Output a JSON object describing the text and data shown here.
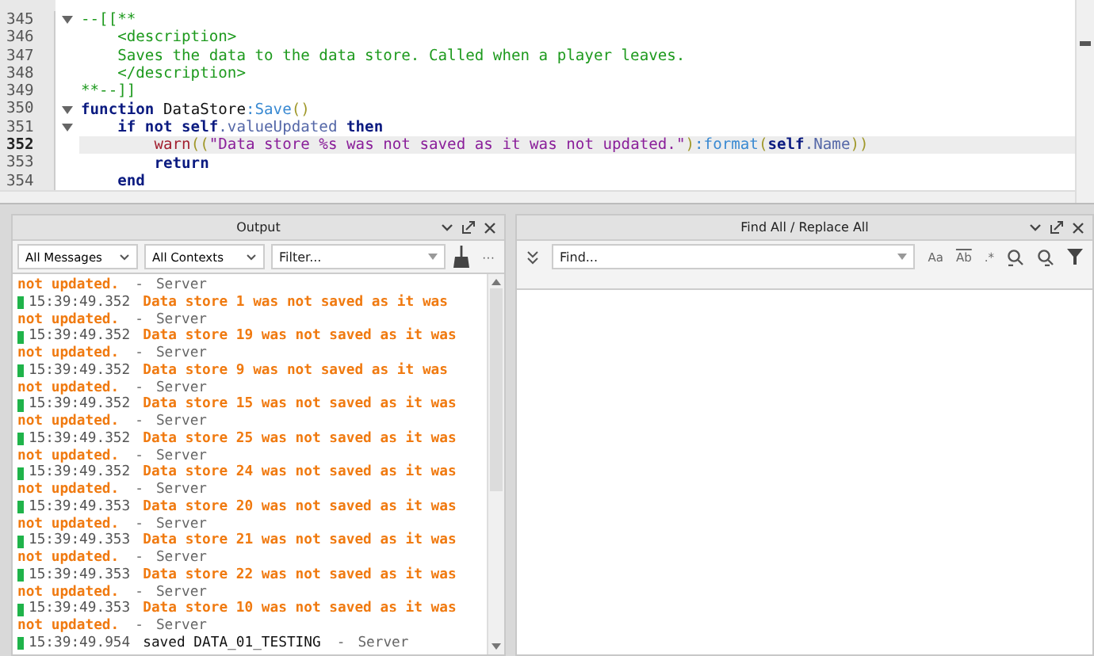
{
  "editor": {
    "lines": [
      {
        "number": "345",
        "fold": true,
        "current": false,
        "tokens": [
          {
            "kind": "comment",
            "text": "--[[**"
          }
        ]
      },
      {
        "number": "346",
        "fold": false,
        "current": false,
        "tokens": [
          {
            "kind": "comment",
            "text": "    <description>"
          }
        ]
      },
      {
        "number": "347",
        "fold": false,
        "current": false,
        "tokens": [
          {
            "kind": "comment",
            "text": "    Saves the data to the data store. Called when a player leaves."
          }
        ]
      },
      {
        "number": "348",
        "fold": false,
        "current": false,
        "tokens": [
          {
            "kind": "comment",
            "text": "    </description>"
          }
        ]
      },
      {
        "number": "349",
        "fold": false,
        "current": false,
        "tokens": [
          {
            "kind": "comment",
            "text": "**--]]"
          }
        ]
      },
      {
        "number": "350",
        "fold": true,
        "current": false,
        "tokens": [
          {
            "kind": "keyword",
            "text": "function"
          },
          {
            "kind": "plain",
            "text": " DataStore"
          },
          {
            "kind": "method",
            "text": ":Save"
          },
          {
            "kind": "paren",
            "text": "()"
          }
        ]
      },
      {
        "number": "351",
        "fold": true,
        "current": false,
        "tokens": [
          {
            "kind": "keyword",
            "text": "    if not self"
          },
          {
            "kind": "property",
            "text": ".valueUpdated"
          },
          {
            "kind": "keyword",
            "text": " then"
          }
        ]
      },
      {
        "number": "352",
        "fold": false,
        "current": true,
        "tokens": [
          {
            "kind": "builtin",
            "text": "        warn"
          },
          {
            "kind": "paren",
            "text": "(("
          },
          {
            "kind": "string",
            "text": "\"Data store %s was not saved as it was not updated.\""
          },
          {
            "kind": "paren",
            "text": ")"
          },
          {
            "kind": "method",
            "text": ":format"
          },
          {
            "kind": "paren",
            "text": "("
          },
          {
            "kind": "keyword",
            "text": "self"
          },
          {
            "kind": "property",
            "text": ".Name"
          },
          {
            "kind": "paren",
            "text": "))"
          }
        ]
      },
      {
        "number": "353",
        "fold": false,
        "current": false,
        "tokens": [
          {
            "kind": "keyword",
            "text": "        return"
          }
        ]
      },
      {
        "number": "354",
        "fold": false,
        "current": false,
        "tokens": [
          {
            "kind": "keyword",
            "text": "    end"
          }
        ]
      }
    ]
  },
  "output": {
    "title": "Output",
    "message_filter": "All Messages",
    "context_filter": "All Contexts",
    "filter_placeholder": "Filter...",
    "more": "···",
    "entries": [
      {
        "kind": "warning",
        "message_lines": [
          "not updated."
        ],
        "separator": "-",
        "source": "Server"
      },
      {
        "kind": "warning",
        "time": "15:39:49.352",
        "message_lines": [
          "Data store 1 was not saved as it was",
          "not updated."
        ],
        "separator": "-",
        "source": "Server"
      },
      {
        "kind": "warning",
        "time": "15:39:49.352",
        "message_lines": [
          "Data store 19 was not saved as it was",
          "not updated."
        ],
        "separator": "-",
        "source": "Server"
      },
      {
        "kind": "warning",
        "time": "15:39:49.352",
        "message_lines": [
          "Data store 9 was not saved as it was",
          "not updated."
        ],
        "separator": "-",
        "source": "Server"
      },
      {
        "kind": "warning",
        "time": "15:39:49.352",
        "message_lines": [
          "Data store 15 was not saved as it was",
          "not updated."
        ],
        "separator": "-",
        "source": "Server"
      },
      {
        "kind": "warning",
        "time": "15:39:49.352",
        "message_lines": [
          "Data store 25 was not saved as it was",
          "not updated."
        ],
        "separator": "-",
        "source": "Server"
      },
      {
        "kind": "warning",
        "time": "15:39:49.352",
        "message_lines": [
          "Data store 24 was not saved as it was",
          "not updated."
        ],
        "separator": "-",
        "source": "Server"
      },
      {
        "kind": "warning",
        "time": "15:39:49.353",
        "message_lines": [
          "Data store 20 was not saved as it was",
          "not updated."
        ],
        "separator": "-",
        "source": "Server"
      },
      {
        "kind": "warning",
        "time": "15:39:49.353",
        "message_lines": [
          "Data store 21 was not saved as it was",
          "not updated."
        ],
        "separator": "-",
        "source": "Server"
      },
      {
        "kind": "warning",
        "time": "15:39:49.353",
        "message_lines": [
          "Data store 22 was not saved as it was",
          "not updated."
        ],
        "separator": "-",
        "source": "Server"
      },
      {
        "kind": "warning",
        "time": "15:39:49.353",
        "message_lines": [
          "Data store 10 was not saved as it was",
          "not updated."
        ],
        "separator": "-",
        "source": "Server"
      },
      {
        "kind": "info",
        "time": "15:39:49.954",
        "message_lines": [
          "saved DATA_01_TESTING"
        ],
        "separator": "-",
        "source": "Server"
      }
    ]
  },
  "find": {
    "title": "Find All / Replace All",
    "placeholder": "Find...",
    "match_case": "Aa",
    "whole_word": "Ab",
    "regex": ".*"
  }
}
